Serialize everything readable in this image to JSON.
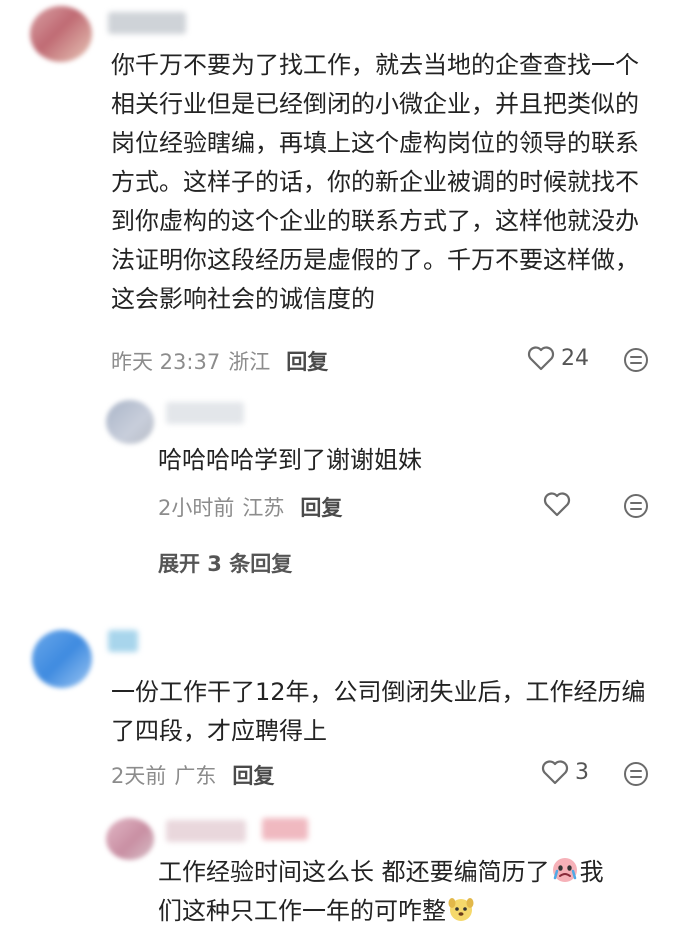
{
  "comments": [
    {
      "text": "你千万不要为了找工作，就去当地的企查查找一个相关行业但是已经倒闭的小微企业，并且把类似的岗位经验瞎编，再填上这个虚构岗位的领导的联系方式。这样子的话，你的新企业被调的时候就找不到你虚构的这个企业的联系方式了，这样他就没办法证明你这段经历是虚假的了。千万不要这样做，这会影响社会的诚信度的",
      "time": "昨天 23:37",
      "location": "浙江",
      "reply_label": "回复",
      "likes": "24",
      "replies": [
        {
          "text": "哈哈哈哈学到了谢谢姐妹",
          "time": "2小时前",
          "location": "江苏",
          "reply_label": "回复",
          "likes": ""
        }
      ],
      "expand_label": "展开 3 条回复"
    },
    {
      "text": "一份工作干了12年，公司倒闭失业后，工作经历编了四段，才应聘得上",
      "time": "2天前",
      "location": "广东",
      "reply_label": "回复",
      "likes": "3",
      "replies": [
        {
          "text_part1": "工作经验时间这么长 都还要编简历了",
          "text_part2": "我",
          "text_part3": "们这种只工作一年的可咋整",
          "emoji_1": "crying-face-emoji",
          "emoji_2": "dog-face-emoji"
        }
      ]
    }
  ],
  "colors": {
    "text": "#232323",
    "meta": "#8c8c8c",
    "icon": "#6b6b6b"
  }
}
